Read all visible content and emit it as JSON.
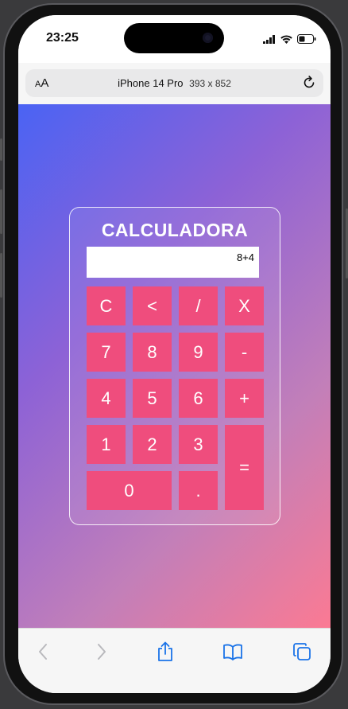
{
  "status_bar": {
    "time": "23:25"
  },
  "browser": {
    "text_size_label_small": "A",
    "text_size_label_large": "A",
    "device_name": "iPhone 14 Pro",
    "viewport_size": "393 x 852"
  },
  "calculator": {
    "title": "CALCULADORA",
    "display_value": "8+4",
    "keys": {
      "clear": "C",
      "backspace": "<",
      "divide": "/",
      "multiply": "X",
      "seven": "7",
      "eight": "8",
      "nine": "9",
      "minus": "-",
      "four": "4",
      "five": "5",
      "six": "6",
      "plus": "+",
      "one": "1",
      "two": "2",
      "three": "3",
      "equals": "=",
      "zero": "0",
      "decimal": "."
    }
  },
  "colors": {
    "key_background": "#ef4d7d",
    "gradient_start": "#4a63f4",
    "gradient_end": "#fb7a93",
    "toolbar_icon_active": "#1a73e8",
    "toolbar_icon_disabled": "#b9b9bd"
  },
  "toolbar_icons": [
    "back-arrow-icon",
    "forward-arrow-icon",
    "share-icon",
    "bookmarks-book-icon",
    "tabs-icon"
  ]
}
